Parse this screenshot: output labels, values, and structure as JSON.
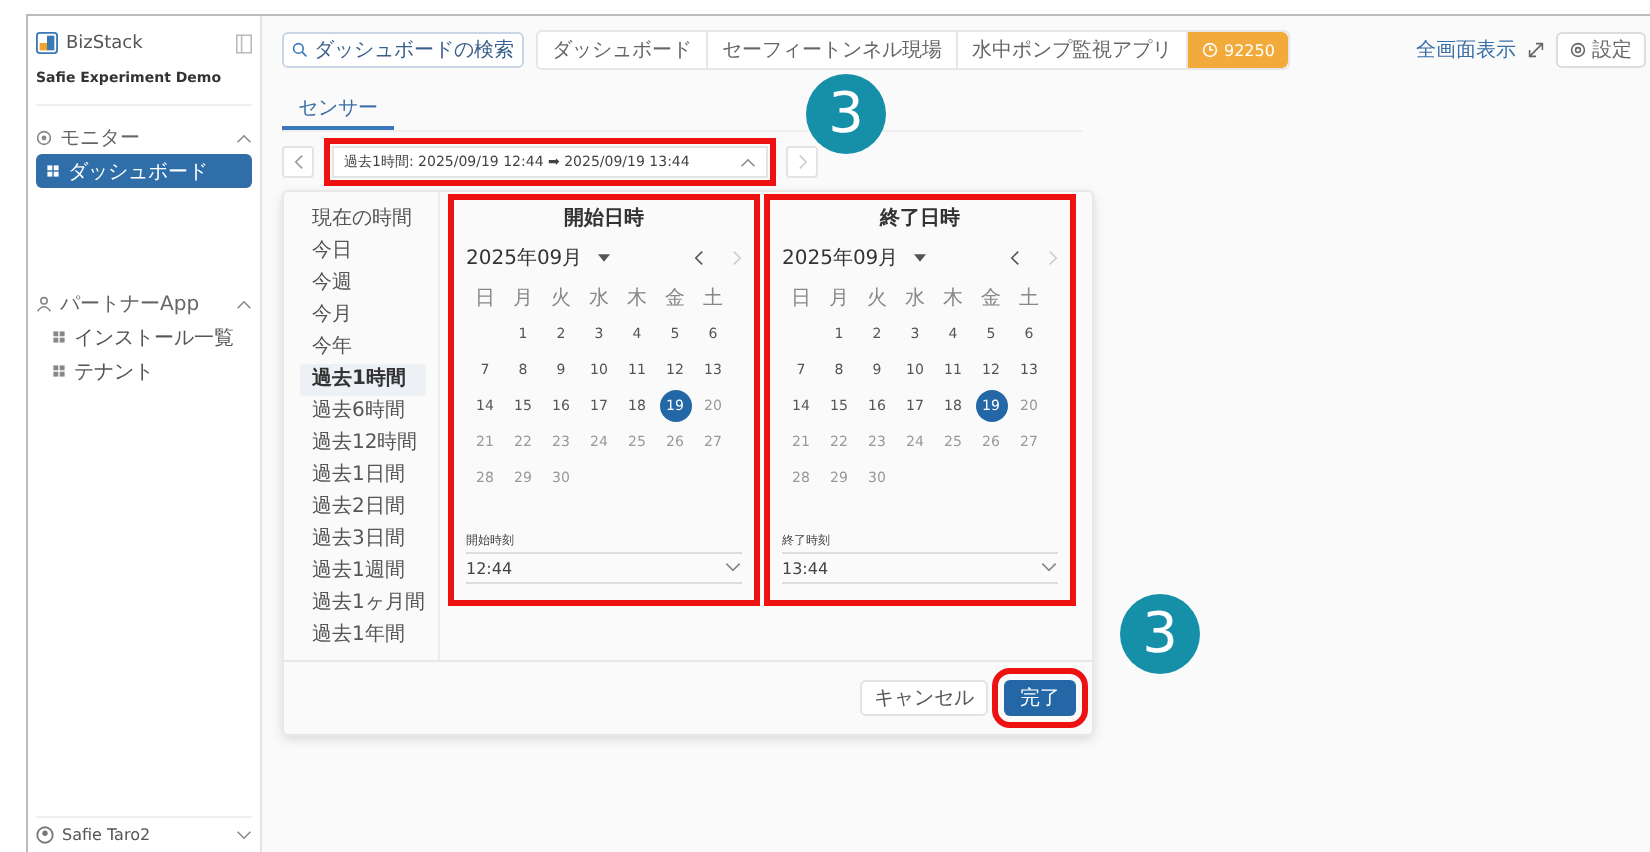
{
  "sidebar": {
    "brand": "BizStack",
    "org": "Safie Experiment Demo",
    "sections": [
      {
        "label": "モニター",
        "expanded": true,
        "items": [
          {
            "label": "ダッシュボード",
            "selected": true
          }
        ]
      },
      {
        "label": "パートナーApp",
        "expanded": true,
        "items": [
          {
            "label": "インストール一覧",
            "selected": false
          },
          {
            "label": "テナント",
            "selected": false
          }
        ]
      }
    ],
    "user": "Safie Taro2"
  },
  "toolbar": {
    "search_button": "ダッシュボードの検索",
    "breadcrumbs": [
      {
        "label": "ダッシュボード",
        "selected": false
      },
      {
        "label": "セーフィートンネル現場",
        "selected": false
      },
      {
        "label": "水中ポンプ監視アプリ",
        "selected": false
      },
      {
        "label": "92250",
        "selected": true
      }
    ],
    "fullscreen": "全画面表示",
    "settings": "設定"
  },
  "tabs": [
    {
      "label": "センサー",
      "selected": true
    }
  ],
  "range": {
    "text": "過去1時間: 2025/09/19 12:44 ➡ 2025/09/19 13:44",
    "expanded": true,
    "highlighted": true
  },
  "picker": {
    "presets": [
      {
        "label": "現在の時間",
        "selected": false
      },
      {
        "label": "今日",
        "selected": false
      },
      {
        "label": "今週",
        "selected": false
      },
      {
        "label": "今月",
        "selected": false
      },
      {
        "label": "今年",
        "selected": false
      },
      {
        "label": "過去1時間",
        "selected": true
      },
      {
        "label": "過去6時間",
        "selected": false
      },
      {
        "label": "過去12時間",
        "selected": false
      },
      {
        "label": "過去1日間",
        "selected": false
      },
      {
        "label": "過去2日間",
        "selected": false
      },
      {
        "label": "過去3日間",
        "selected": false
      },
      {
        "label": "過去1週間",
        "selected": false
      },
      {
        "label": "過去1ヶ月間",
        "selected": false
      },
      {
        "label": "過去1年間",
        "selected": false
      }
    ],
    "calendars": [
      {
        "title": "開始日時",
        "month": "2025年09月",
        "highlighted": true,
        "next_disabled": true,
        "weekdays": [
          "日",
          "月",
          "火",
          "水",
          "木",
          "金",
          "土"
        ],
        "days": [
          {
            "kind": "blank"
          },
          {
            "kind": "day",
            "d": "1",
            "selected": false,
            "disabled": false
          },
          {
            "kind": "day",
            "d": "2",
            "selected": false,
            "disabled": false
          },
          {
            "kind": "day",
            "d": "3",
            "selected": false,
            "disabled": false
          },
          {
            "kind": "day",
            "d": "4",
            "selected": false,
            "disabled": false
          },
          {
            "kind": "day",
            "d": "5",
            "selected": false,
            "disabled": false
          },
          {
            "kind": "day",
            "d": "6",
            "selected": false,
            "disabled": false
          },
          {
            "kind": "day",
            "d": "7",
            "selected": false,
            "disabled": false
          },
          {
            "kind": "day",
            "d": "8",
            "selected": false,
            "disabled": false
          },
          {
            "kind": "day",
            "d": "9",
            "selected": false,
            "disabled": false
          },
          {
            "kind": "day",
            "d": "10",
            "selected": false,
            "disabled": false
          },
          {
            "kind": "day",
            "d": "11",
            "selected": false,
            "disabled": false
          },
          {
            "kind": "day",
            "d": "12",
            "selected": false,
            "disabled": false
          },
          {
            "kind": "day",
            "d": "13",
            "selected": false,
            "disabled": false
          },
          {
            "kind": "day",
            "d": "14",
            "selected": false,
            "disabled": false
          },
          {
            "kind": "day",
            "d": "15",
            "selected": false,
            "disabled": false
          },
          {
            "kind": "day",
            "d": "16",
            "selected": false,
            "disabled": false
          },
          {
            "kind": "day",
            "d": "17",
            "selected": false,
            "disabled": false
          },
          {
            "kind": "day",
            "d": "18",
            "selected": false,
            "disabled": false
          },
          {
            "kind": "day",
            "d": "19",
            "selected": true,
            "disabled": false
          },
          {
            "kind": "day",
            "d": "20",
            "selected": false,
            "disabled": true
          },
          {
            "kind": "day",
            "d": "21",
            "selected": false,
            "disabled": true
          },
          {
            "kind": "day",
            "d": "22",
            "selected": false,
            "disabled": true
          },
          {
            "kind": "day",
            "d": "23",
            "selected": false,
            "disabled": true
          },
          {
            "kind": "day",
            "d": "24",
            "selected": false,
            "disabled": true
          },
          {
            "kind": "day",
            "d": "25",
            "selected": false,
            "disabled": true
          },
          {
            "kind": "day",
            "d": "26",
            "selected": false,
            "disabled": true
          },
          {
            "kind": "day",
            "d": "27",
            "selected": false,
            "disabled": true
          },
          {
            "kind": "day",
            "d": "28",
            "selected": false,
            "disabled": true
          },
          {
            "kind": "day",
            "d": "29",
            "selected": false,
            "disabled": true
          },
          {
            "kind": "day",
            "d": "30",
            "selected": false,
            "disabled": true
          }
        ],
        "time_label": "開始時刻",
        "time": "12:44"
      },
      {
        "title": "終了日時",
        "month": "2025年09月",
        "highlighted": true,
        "next_disabled": true,
        "weekdays": [
          "日",
          "月",
          "火",
          "水",
          "木",
          "金",
          "土"
        ],
        "days": [
          {
            "kind": "blank"
          },
          {
            "kind": "day",
            "d": "1",
            "selected": false,
            "disabled": false
          },
          {
            "kind": "day",
            "d": "2",
            "selected": false,
            "disabled": false
          },
          {
            "kind": "day",
            "d": "3",
            "selected": false,
            "disabled": false
          },
          {
            "kind": "day",
            "d": "4",
            "selected": false,
            "disabled": false
          },
          {
            "kind": "day",
            "d": "5",
            "selected": false,
            "disabled": false
          },
          {
            "kind": "day",
            "d": "6",
            "selected": false,
            "disabled": false
          },
          {
            "kind": "day",
            "d": "7",
            "selected": false,
            "disabled": false
          },
          {
            "kind": "day",
            "d": "8",
            "selected": false,
            "disabled": false
          },
          {
            "kind": "day",
            "d": "9",
            "selected": false,
            "disabled": false
          },
          {
            "kind": "day",
            "d": "10",
            "selected": false,
            "disabled": false
          },
          {
            "kind": "day",
            "d": "11",
            "selected": false,
            "disabled": false
          },
          {
            "kind": "day",
            "d": "12",
            "selected": false,
            "disabled": false
          },
          {
            "kind": "day",
            "d": "13",
            "selected": false,
            "disabled": false
          },
          {
            "kind": "day",
            "d": "14",
            "selected": false,
            "disabled": false
          },
          {
            "kind": "day",
            "d": "15",
            "selected": false,
            "disabled": false
          },
          {
            "kind": "day",
            "d": "16",
            "selected": false,
            "disabled": false
          },
          {
            "kind": "day",
            "d": "17",
            "selected": false,
            "disabled": false
          },
          {
            "kind": "day",
            "d": "18",
            "selected": false,
            "disabled": false
          },
          {
            "kind": "day",
            "d": "19",
            "selected": true,
            "disabled": false
          },
          {
            "kind": "day",
            "d": "20",
            "selected": false,
            "disabled": true
          },
          {
            "kind": "day",
            "d": "21",
            "selected": false,
            "disabled": true
          },
          {
            "kind": "day",
            "d": "22",
            "selected": false,
            "disabled": true
          },
          {
            "kind": "day",
            "d": "23",
            "selected": false,
            "disabled": true
          },
          {
            "kind": "day",
            "d": "24",
            "selected": false,
            "disabled": true
          },
          {
            "kind": "day",
            "d": "25",
            "selected": false,
            "disabled": true
          },
          {
            "kind": "day",
            "d": "26",
            "selected": false,
            "disabled": true
          },
          {
            "kind": "day",
            "d": "27",
            "selected": false,
            "disabled": true
          },
          {
            "kind": "day",
            "d": "28",
            "selected": false,
            "disabled": true
          },
          {
            "kind": "day",
            "d": "29",
            "selected": false,
            "disabled": true
          },
          {
            "kind": "day",
            "d": "30",
            "selected": false,
            "disabled": true
          }
        ],
        "time_label": "終了時刻",
        "time": "13:44"
      }
    ],
    "cancel": "キャンセル",
    "done": {
      "label": "完了",
      "highlighted": true
    }
  },
  "callouts": [
    {
      "label": "3"
    },
    {
      "label": "3"
    }
  ]
}
